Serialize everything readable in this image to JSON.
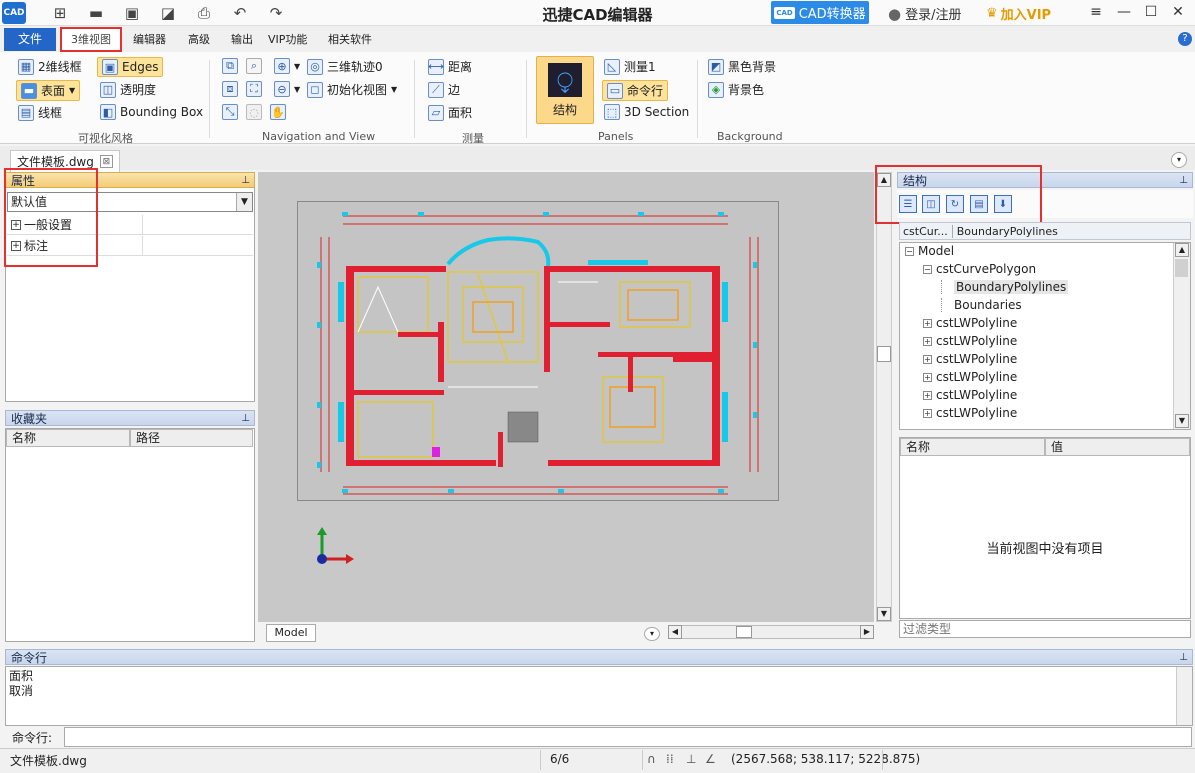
{
  "app": {
    "title": "迅捷CAD编辑器",
    "logo_text": "CAD",
    "converter_label": "CAD转换器",
    "converter_icon_text": "CAD",
    "login_label": "登录/注册",
    "vip_label": "加入VIP"
  },
  "menu": {
    "file": "文件",
    "tabs": [
      "3维视图",
      "编辑器",
      "高级",
      "输出",
      "VIP功能",
      "相关软件"
    ]
  },
  "ribbon": {
    "visual_style": {
      "group_label": "可视化风格",
      "wireframe2d": "2维线框",
      "surface": "表面",
      "wireframe": "线框",
      "edges": "Edges",
      "transparency": "透明度",
      "bounding_box": "Bounding Box"
    },
    "navigation": {
      "group_label": "Navigation and View",
      "orbit3d": "三维轨迹0",
      "init_view": "初始化视图"
    },
    "measure": {
      "group_label": "测量",
      "distance": "距离",
      "edge": "边",
      "area": "面积"
    },
    "panels": {
      "group_label": "Panels",
      "structure": "结构",
      "measure1": "测量1",
      "command_line": "命令行",
      "section3d": "3D Section"
    },
    "background": {
      "group_label": "Background",
      "black_bg": "黑色背景",
      "bg_color": "背景色"
    }
  },
  "document": {
    "tab_name": "文件模板.dwg",
    "close": "⊠",
    "model_tab": "Model"
  },
  "properties": {
    "title": "属性",
    "selected": "默认值",
    "rows": [
      "一般设置",
      "标注"
    ]
  },
  "favorites": {
    "title": "收藏夹",
    "col_name": "名称",
    "col_path": "路径"
  },
  "structure": {
    "title": "结构",
    "crumbs": [
      "cstCur...",
      "BoundaryPolylines"
    ],
    "tree": [
      {
        "label": "Model",
        "level": 0,
        "toggle": "−"
      },
      {
        "label": "cstCurvePolygon",
        "level": 1,
        "toggle": "−"
      },
      {
        "label": "BoundaryPolylines",
        "level": 2,
        "toggle": "",
        "selected": true
      },
      {
        "label": "Boundaries",
        "level": 2,
        "toggle": ""
      },
      {
        "label": "cstLWPolyline",
        "level": 1,
        "toggle": "+"
      },
      {
        "label": "cstLWPolyline",
        "level": 1,
        "toggle": "+"
      },
      {
        "label": "cstLWPolyline",
        "level": 1,
        "toggle": "+"
      },
      {
        "label": "cstLWPolyline",
        "level": 1,
        "toggle": "+"
      },
      {
        "label": "cstLWPolyline",
        "level": 1,
        "toggle": "+"
      },
      {
        "label": "cstLWPolyline",
        "level": 1,
        "toggle": "+"
      }
    ],
    "col_name": "名称",
    "col_value": "值",
    "empty_message": "当前视图中没有项目",
    "filter_placeholder": "过滤类型"
  },
  "command": {
    "title": "命令行",
    "history": [
      "面积",
      "取消"
    ],
    "input_label": "命令行:"
  },
  "status": {
    "file": "文件模板.dwg",
    "page": "6/6",
    "coords": "(2567.568; 538.117; 5228.875)"
  }
}
